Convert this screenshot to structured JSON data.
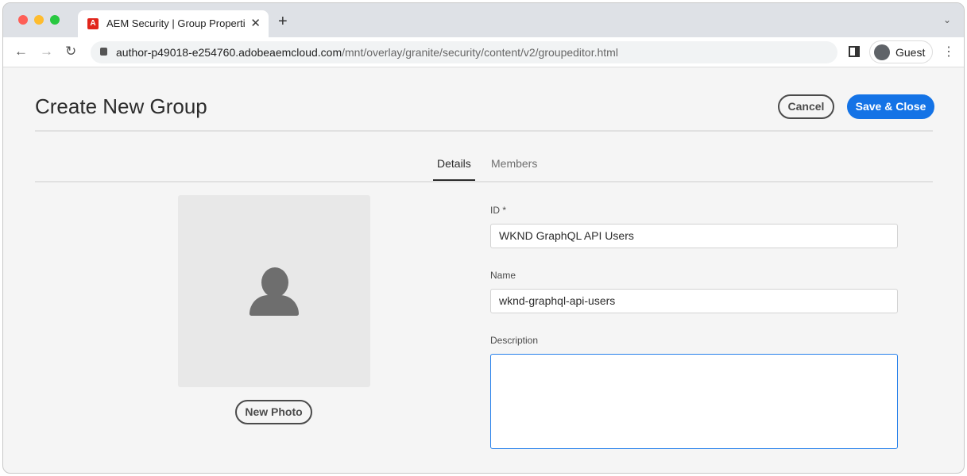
{
  "browser": {
    "tab_title": "AEM Security | Group Properties",
    "url_host": "author-p49018-e254760.adobeaemcloud.com",
    "url_path": "/mnt/overlay/granite/security/content/v2/groupeditor.html",
    "profile": "Guest",
    "favicon_letter": "A"
  },
  "page": {
    "title": "Create New Group",
    "cancel_label": "Cancel",
    "save_label": "Save & Close",
    "tabs": [
      {
        "label": "Details",
        "active": true
      },
      {
        "label": "Members",
        "active": false
      }
    ],
    "new_photo_label": "New Photo",
    "fields": {
      "id_label": "ID *",
      "id_value": "WKND GraphQL API Users",
      "name_label": "Name",
      "name_value": "wknd-graphql-api-users",
      "description_label": "Description",
      "description_value": ""
    }
  },
  "colors": {
    "accent": "#1473e6",
    "focus": "#2680eb"
  }
}
